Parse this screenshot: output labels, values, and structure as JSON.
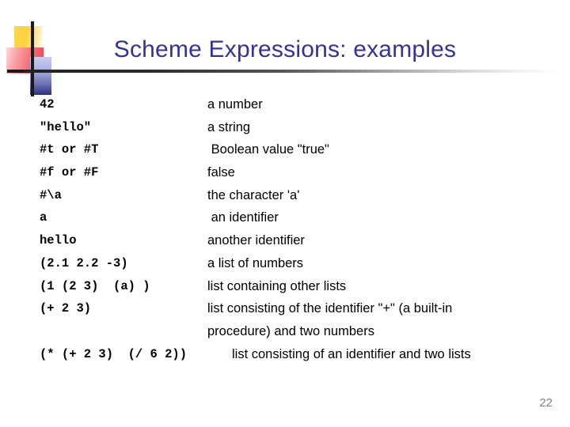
{
  "slide": {
    "title": "Scheme Expressions: examples",
    "page_number": "22",
    "title_color": "#333399",
    "page_number_color": "#808080",
    "decoration": {
      "yellow": "#ffd23c",
      "red": "#f4626d",
      "blue": "#6a72b8",
      "navy": "#2b2f7c",
      "cross": "#1a1a1a"
    }
  },
  "table": {
    "rows": [
      {
        "code": "42",
        "desc": "a number"
      },
      {
        "code": "\"hello\"",
        "desc": "a string"
      },
      {
        "code": "#t or #T",
        "desc": " Boolean value \"true\""
      },
      {
        "code": "#f or #F",
        "desc": "false"
      },
      {
        "code": "#\\a",
        "desc": "the character 'a'"
      },
      {
        "code": "a",
        "desc": " an identifier"
      },
      {
        "code": "hello",
        "desc": "another identifier"
      },
      {
        "code": "(2.1 2.2 -3)",
        "desc": "a list of numbers"
      },
      {
        "code": "(1 (2 3)  (a) )",
        "desc": "list containing other lists"
      },
      {
        "code": "(+ 2 3)",
        "desc": "list consisting of the identifier \"+\" (a built-in"
      },
      {
        "code": "",
        "desc": "procedure) and two numbers"
      },
      {
        "code": "(* (+ 2 3)  (/ 6 2))",
        "desc": "list consisting of an identifier and two lists",
        "wide": true
      }
    ]
  }
}
